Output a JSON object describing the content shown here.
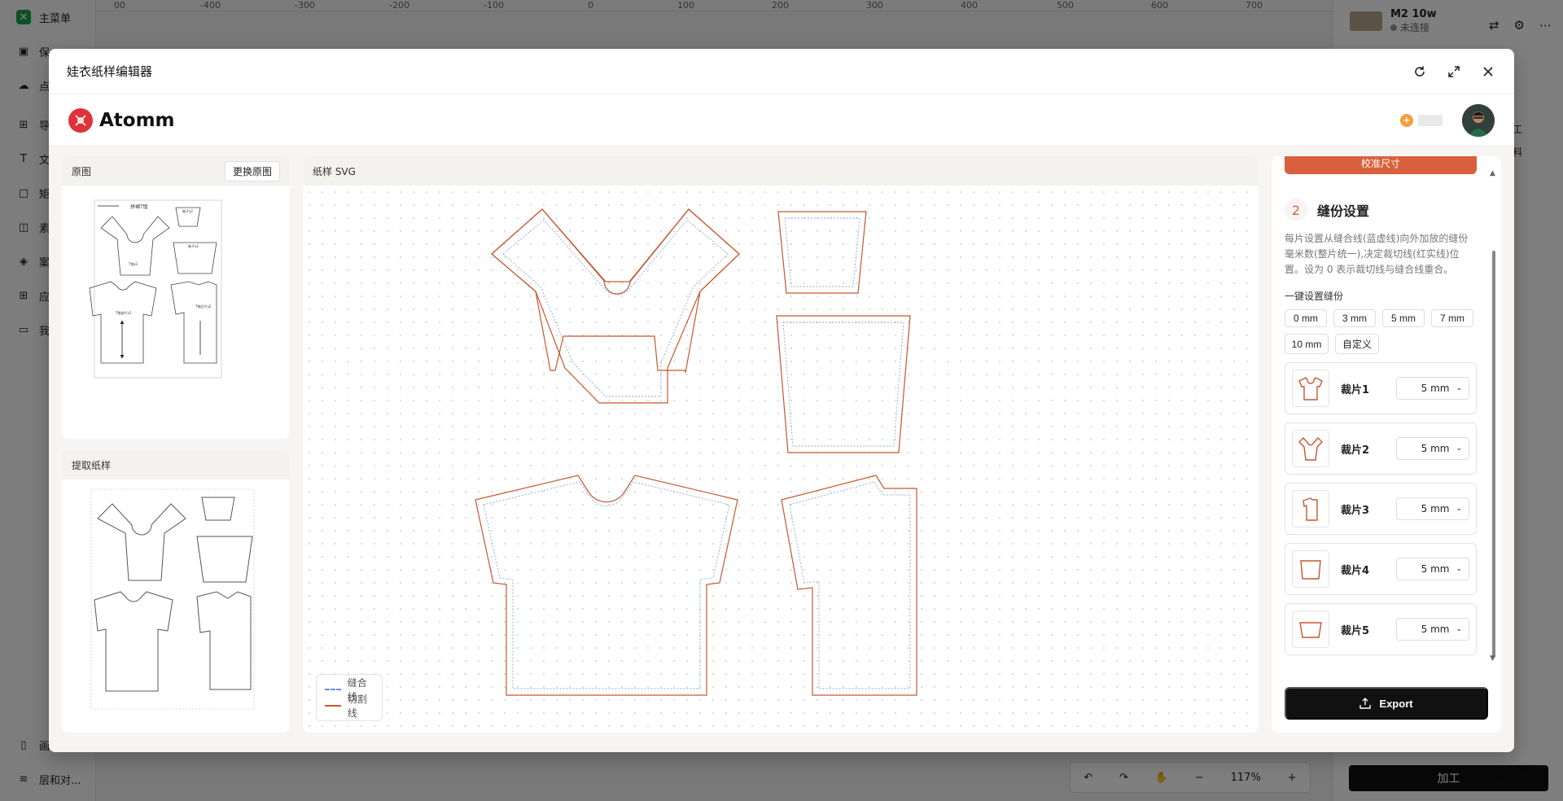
{
  "bg": {
    "sidebar": {
      "logo_label": "主菜单",
      "items": [
        "保",
        "点",
        "导",
        "文",
        "矩",
        "素",
        "案",
        "应",
        "我",
        "画",
        "层和对..."
      ]
    },
    "ruler": [
      "00",
      "-400",
      "-300",
      "-200",
      "-100",
      "0",
      "100",
      "200",
      "300",
      "400",
      "500",
      "600",
      "700"
    ],
    "device": {
      "name": "M2 10w",
      "status": "未连接"
    },
    "right_labels": [
      "工",
      "料"
    ],
    "zoom": "117%",
    "process_label": "加工"
  },
  "modal": {
    "title": "娃衣纸样编辑器",
    "brand": "Atomm",
    "panels": {
      "original": {
        "title": "原图",
        "replace_button": "更换原图"
      },
      "extract": {
        "title": "提取纸样"
      },
      "svg": {
        "title": "纸样 SVG"
      }
    },
    "legend": {
      "seam": "缝合线",
      "cut": "切割线"
    },
    "colors": {
      "accent": "#d9603c",
      "seam": "#6b8fd6",
      "cut": "#c5572f"
    },
    "settings": {
      "calibrate_button": "校准尺寸",
      "step_number": "2",
      "step_title": "缝份设置",
      "description": "每片设置从缝合线(蓝虚线)向外加放的缝份毫米数(整片统一),决定裁切线(红实线)位置。设为 0 表示裁切线与缝合线重合。",
      "quick_label": "一键设置缝份",
      "quick_options": [
        "0 mm",
        "3 mm",
        "5 mm",
        "7 mm",
        "10 mm",
        "自定义"
      ],
      "pieces": [
        {
          "name": "裁片1",
          "value": "5 mm"
        },
        {
          "name": "裁片2",
          "value": "5 mm"
        },
        {
          "name": "裁片3",
          "value": "5 mm"
        },
        {
          "name": "裁片4",
          "value": "5 mm"
        },
        {
          "name": "裁片5",
          "value": "5 mm"
        }
      ],
      "export_label": "Export"
    },
    "original_sheet": {
      "title": "拼裙T恤",
      "labels": [
        "袖子x2",
        "袖子x2",
        "T恤x1",
        "T恤前片x1",
        "T恤后片x2"
      ]
    }
  }
}
